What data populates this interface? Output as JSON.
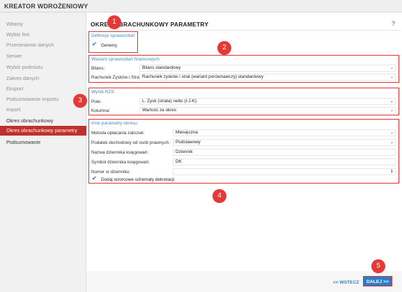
{
  "app_title": "KREATOR WDROŻENIOWY",
  "sidebar": {
    "items": [
      {
        "label": "Witamy",
        "state": "pending"
      },
      {
        "label": "Wybór linii",
        "state": "pending"
      },
      {
        "label": "Przeniesienie danych",
        "state": "pending"
      },
      {
        "label": "Serwer",
        "state": "pending"
      },
      {
        "label": "Wybór podmiotu",
        "state": "pending"
      },
      {
        "label": "Zakres danych",
        "state": "pending"
      },
      {
        "label": "Eksport",
        "state": "pending"
      },
      {
        "label": "Podsumowanie importu",
        "state": "pending"
      },
      {
        "label": "Import",
        "state": "pending"
      },
      {
        "label": "Okres obrachunkowy",
        "state": "done"
      },
      {
        "label": "Okres obrachunkowy parametry",
        "state": "active"
      },
      {
        "label": "Podsumowanie",
        "state": "done"
      }
    ]
  },
  "page": {
    "title": "OKRES OBRACHUNKOWY PARAMETRY",
    "help": "?"
  },
  "sections": {
    "definicje": {
      "title": "Definicje sprawozdań",
      "checkbox_label": "Generuj",
      "checked": true
    },
    "wariant": {
      "title": "Wariant sprawozdań finansowych",
      "bilans_label": "Bilans:",
      "bilans_value": "Bilans standardowy",
      "rzis_label": "Rachunek Zysków i Strat:",
      "rzis_value": "Rachunek zysków i strat (wariant porównawczy) standardowy"
    },
    "wynik": {
      "title": "Wynik RZS",
      "pole_label": "Pole:",
      "pole_value": "L. Zysk (strata) netto (I-J-K)",
      "kolumna_label": "Kolumna:",
      "kolumna_value": "Wartość za okres"
    },
    "inne": {
      "title": "Inne parametry okresu",
      "metoda_label": "Metoda opłacania zaliczek:",
      "metoda_value": "Miesięczna",
      "podatek_label": "Podatek dochodowy od osób prawnych:",
      "podatek_value": "Podstawowy",
      "nazwa_label": "Nazwa dziennika księgowań:",
      "nazwa_value": "Dziennik",
      "symbol_label": "Symbol dziennika księgowań:",
      "symbol_value": "DK",
      "numer_label": "Numer w dzienniku:",
      "numer_value": "1",
      "checkbox_label": "Dodaj wzorcowe schematy dekretacji",
      "checked": true
    }
  },
  "badges": [
    "1",
    "2",
    "3",
    "4",
    "5"
  ],
  "footer": {
    "back_label": "<< WSTECZ",
    "next_label": "DALEJ >>"
  },
  "colors": {
    "accent_red": "#c0302d",
    "link_blue": "#2f7fc4",
    "button_blue": "#2a7ec8",
    "annotation_red": "#e53935"
  }
}
